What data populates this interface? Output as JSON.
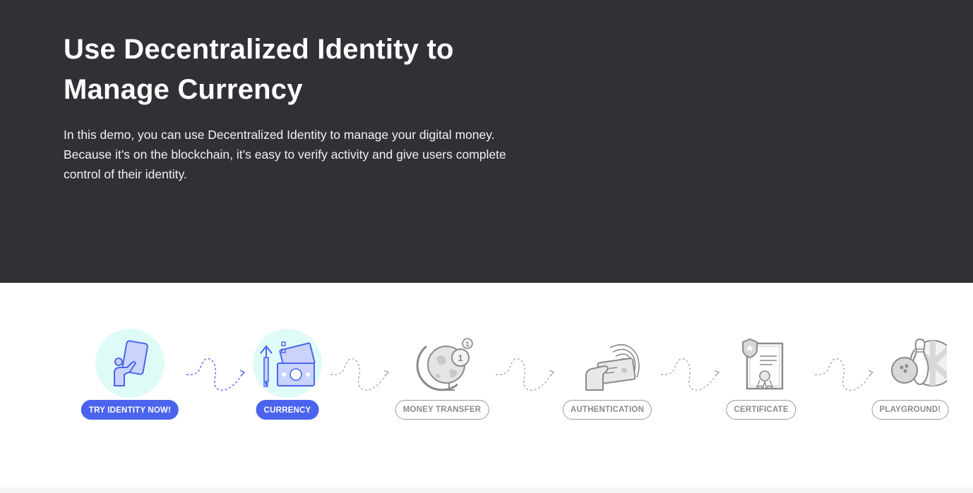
{
  "hero": {
    "title_line1": "Use Decentralized Identity to",
    "title_line2": "Manage Currency",
    "description": "In this demo, you can use Decentralized Identity to manage your digital money. Because it’s on the blockchain, it’s easy to verify activity and give users complete control of their identity."
  },
  "steps": [
    {
      "label": "TRY IDENTITY NOW!",
      "icon": "phone-hand-icon",
      "state": "active"
    },
    {
      "label": "CURRENCY",
      "icon": "currency-bills-icon",
      "state": "active"
    },
    {
      "label": "MONEY TRANSFER",
      "icon": "globe-coin-icon",
      "state": "inactive"
    },
    {
      "label": "AUTHENTICATION",
      "icon": "fingerprint-card-icon",
      "state": "inactive"
    },
    {
      "label": "CERTIFICATE",
      "icon": "certificate-icon",
      "state": "inactive"
    },
    {
      "label": "PLAYGROUND!",
      "icon": "bowling-icon",
      "state": "inactive"
    }
  ],
  "colors": {
    "hero_background": "#303136",
    "accent": "#4a64ee",
    "active_circle": "#dffbf8",
    "inactive_gray": "#9a9a9a"
  }
}
